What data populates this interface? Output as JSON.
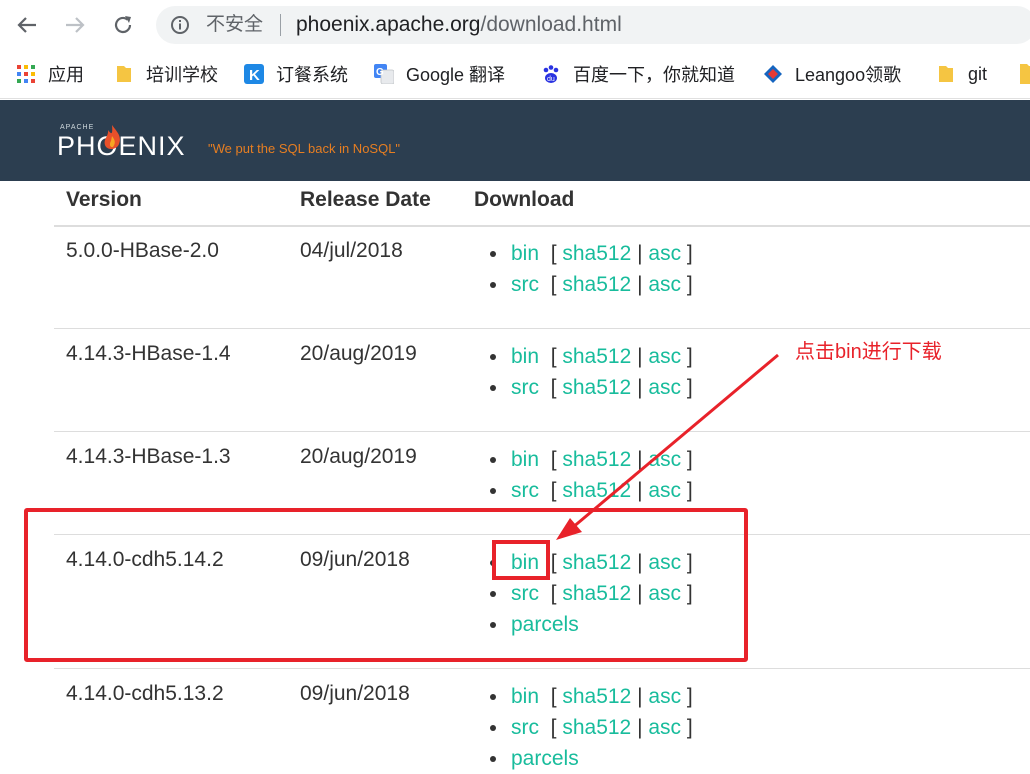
{
  "browser": {
    "security_label": "不安全",
    "url_host": "phoenix.apache.org",
    "url_path": "/download.html"
  },
  "bookmarks": [
    {
      "label": "应用",
      "icon": "apps-grid-icon"
    },
    {
      "label": "培训学校",
      "icon": "folder-icon"
    },
    {
      "label": "订餐系统",
      "icon": "k-app-icon"
    },
    {
      "label": "Google 翻译",
      "icon": "google-translate-icon"
    },
    {
      "label": "百度一下，你就知道",
      "icon": "baidu-paw-icon"
    },
    {
      "label": "Leangoo领歌",
      "icon": "leangoo-icon"
    },
    {
      "label": "git",
      "icon": "folder-icon"
    }
  ],
  "site": {
    "logo_small": "APACHE",
    "logo_text": "PHOENIX",
    "tagline": "\"We put the SQL back in NoSQL\""
  },
  "table": {
    "headers": [
      "Version",
      "Release Date",
      "Download"
    ],
    "rows": [
      {
        "version": "5.0.0-HBase-2.0",
        "date": "04/jul/2018",
        "links": [
          {
            "name": "bin",
            "sha": "sha512",
            "asc": "asc"
          },
          {
            "name": "src",
            "sha": "sha512",
            "asc": "asc"
          }
        ]
      },
      {
        "version": "4.14.3-HBase-1.4",
        "date": "20/aug/2019",
        "links": [
          {
            "name": "bin",
            "sha": "sha512",
            "asc": "asc"
          },
          {
            "name": "src",
            "sha": "sha512",
            "asc": "asc"
          }
        ]
      },
      {
        "version": "4.14.3-HBase-1.3",
        "date": "20/aug/2019",
        "links": [
          {
            "name": "bin",
            "sha": "sha512",
            "asc": "asc"
          },
          {
            "name": "src",
            "sha": "sha512",
            "asc": "asc"
          }
        ]
      },
      {
        "version": "4.14.0-cdh5.14.2",
        "date": "09/jun/2018",
        "links": [
          {
            "name": "bin",
            "sha": "sha512",
            "asc": "asc"
          },
          {
            "name": "src",
            "sha": "sha512",
            "asc": "asc"
          },
          {
            "name": "parcels"
          }
        ]
      },
      {
        "version": "4.14.0-cdh5.13.2",
        "date": "09/jun/2018",
        "links": [
          {
            "name": "bin",
            "sha": "sha512",
            "asc": "asc"
          },
          {
            "name": "src",
            "sha": "sha512",
            "asc": "asc"
          },
          {
            "name": "parcels"
          }
        ]
      }
    ]
  },
  "annotation": {
    "text": "点击bin进行下载",
    "color": "#e8222a"
  },
  "colors": {
    "header_bg": "#2c3e50",
    "link": "#18bc9c",
    "tagline": "#e67e22"
  }
}
